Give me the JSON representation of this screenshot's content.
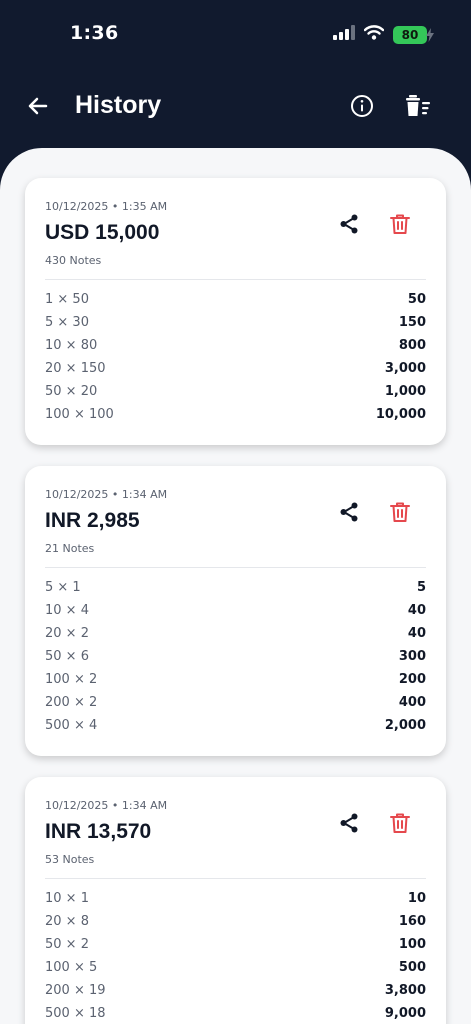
{
  "status": {
    "time": "1:36",
    "battery": "80"
  },
  "header": {
    "title": "History"
  },
  "icons": {
    "back": "arrow-left-icon",
    "info": "info-circle-icon",
    "clear": "clear-all-icon",
    "share": "share-icon",
    "delete": "trash-icon"
  },
  "colors": {
    "header_bg": "#111a2e",
    "content_bg": "#f6f7f9",
    "delete_red": "#e5484d",
    "battery_green": "#34c759"
  },
  "history": [
    {
      "date": "10/12/2025 • 1:35 AM",
      "total": "USD 15,000",
      "notes": "430 Notes",
      "rows": [
        {
          "denom": "1 × 50",
          "amount": "50"
        },
        {
          "denom": "5 × 30",
          "amount": "150"
        },
        {
          "denom": "10 × 80",
          "amount": "800"
        },
        {
          "denom": "20 × 150",
          "amount": "3,000"
        },
        {
          "denom": "50 × 20",
          "amount": "1,000"
        },
        {
          "denom": "100 × 100",
          "amount": "10,000"
        }
      ]
    },
    {
      "date": "10/12/2025 • 1:34 AM",
      "total": "INR 2,985",
      "notes": "21 Notes",
      "rows": [
        {
          "denom": "5 × 1",
          "amount": "5"
        },
        {
          "denom": "10 × 4",
          "amount": "40"
        },
        {
          "denom": "20 × 2",
          "amount": "40"
        },
        {
          "denom": "50 × 6",
          "amount": "300"
        },
        {
          "denom": "100 × 2",
          "amount": "200"
        },
        {
          "denom": "200 × 2",
          "amount": "400"
        },
        {
          "denom": "500 × 4",
          "amount": "2,000"
        }
      ]
    },
    {
      "date": "10/12/2025 • 1:34 AM",
      "total": "INR 13,570",
      "notes": "53 Notes",
      "rows": [
        {
          "denom": "10 × 1",
          "amount": "10"
        },
        {
          "denom": "20 × 8",
          "amount": "160"
        },
        {
          "denom": "50 × 2",
          "amount": "100"
        },
        {
          "denom": "100 × 5",
          "amount": "500"
        },
        {
          "denom": "200 × 19",
          "amount": "3,800"
        },
        {
          "denom": "500 × 18",
          "amount": "9,000"
        }
      ]
    }
  ]
}
